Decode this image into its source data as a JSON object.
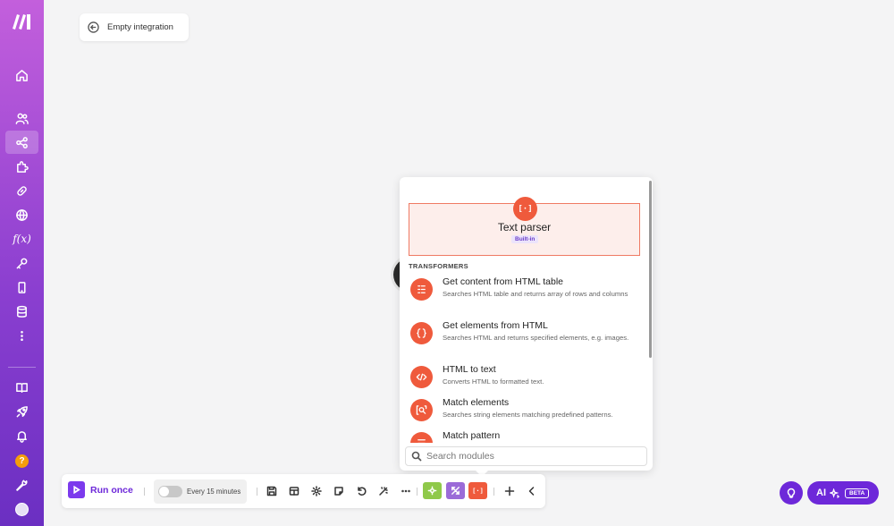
{
  "header": {
    "back_label": "Empty integration"
  },
  "module_panel": {
    "featured": {
      "icon_text": "[·]",
      "title": "Text parser",
      "badge": "Built-in"
    },
    "section_title": "TRANSFORMERS",
    "modules": [
      {
        "title": "Get content from HTML table",
        "description": "Searches HTML table and returns array of rows and columns",
        "icon": "table-list-icon"
      },
      {
        "title": "Get elements from HTML",
        "description": "Searches HTML and returns specified elements, e.g. images.",
        "icon": "html-brackets-icon"
      },
      {
        "title": "HTML to text",
        "description": "Converts HTML to formatted text.",
        "icon": "code-tag-icon"
      },
      {
        "title": "Match elements",
        "description": "Searches string elements matching predefined patterns.",
        "icon": "search-match-icon"
      },
      {
        "title": "Match pattern",
        "description": "",
        "icon": "pattern-icon"
      }
    ],
    "search": {
      "placeholder": "Search modules",
      "value": ""
    }
  },
  "toolbar": {
    "run_label": "Run once",
    "schedule_label": "Every 15 minutes",
    "schedule_enabled": false,
    "text_parser_icon_text": "[·]",
    "colors": {
      "tools": "#8fc94a",
      "flow": "#9b6bd8",
      "text_parser": "#ef5a3c",
      "accent": "#6d28d9"
    }
  },
  "ai": {
    "label": "AI",
    "badge": "BETA"
  }
}
